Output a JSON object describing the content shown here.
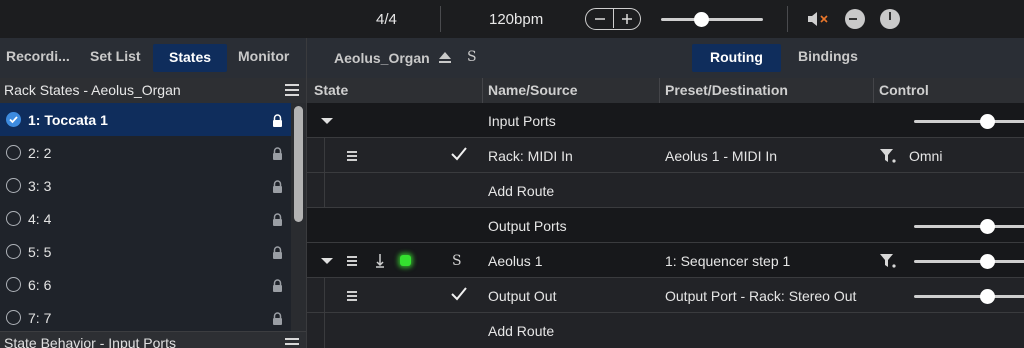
{
  "transport": {
    "time_signature": "4/4",
    "tempo": "120bpm",
    "tempo_minus_icon": "minus-icon",
    "tempo_plus_icon": "plus-icon",
    "volume_level": 0.4,
    "mute_icon": "speaker-muted-icon"
  },
  "left_tabs": [
    {
      "label": "Recordi...",
      "active": false
    },
    {
      "label": "Set List",
      "active": false
    },
    {
      "label": "States",
      "active": true
    },
    {
      "label": "Monitor",
      "active": false
    }
  ],
  "rack_states": {
    "title": "Rack States - Aeolus_Organ",
    "items": [
      {
        "label": "1: Toccata 1",
        "selected": true
      },
      {
        "label": "2: 2",
        "selected": false
      },
      {
        "label": "3: 3",
        "selected": false
      },
      {
        "label": "4: 4",
        "selected": false
      },
      {
        "label": "5: 5",
        "selected": false
      },
      {
        "label": "6: 6",
        "selected": false
      },
      {
        "label": "7: 7",
        "selected": false
      }
    ]
  },
  "state_behavior": {
    "title": "State Behavior - Input Ports"
  },
  "rack_header": {
    "rack_name": "Aeolus_Organ",
    "solo": "S",
    "tabs": [
      {
        "label": "Routing",
        "active": true
      },
      {
        "label": "Bindings",
        "active": false
      }
    ]
  },
  "columns": [
    "State",
    "Name/Source",
    "Preset/Destination",
    "Control"
  ],
  "rows": {
    "input_ports": {
      "name": "Input Ports",
      "level": 0.66
    },
    "rack_midi_in": {
      "name": "Rack: MIDI In",
      "destination": "Aeolus 1 - MIDI In",
      "control": "Omni"
    },
    "add_route_1": {
      "name": "Add Route"
    },
    "output_ports": {
      "name": "Output Ports",
      "level": 0.66
    },
    "aeolus_1": {
      "name": "Aeolus 1",
      "solo": "S",
      "destination": "1: Sequencer step 1",
      "level": 0.66
    },
    "output_out": {
      "name": "Output Out",
      "destination": "Output Port - Rack: Stereo Out",
      "level": 0.66
    },
    "add_route_2": {
      "name": "Add Route"
    }
  },
  "colors": {
    "accent": "#0f2d5c",
    "check_blue": "#3d8bdf",
    "led_green": "#34e02f"
  }
}
